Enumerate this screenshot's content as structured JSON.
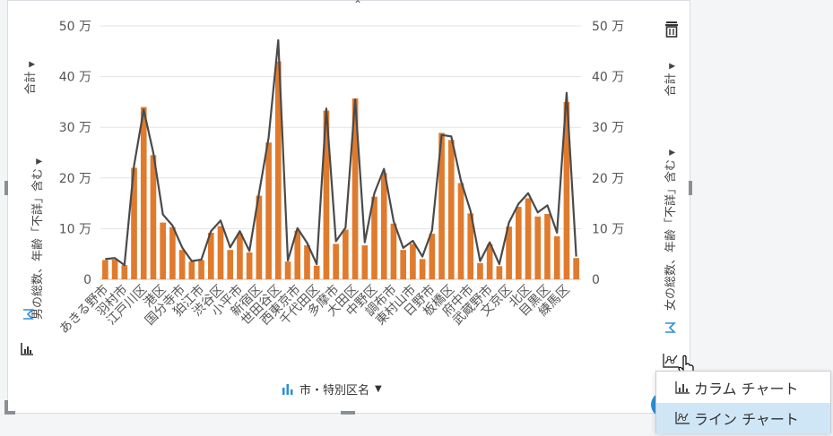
{
  "chart_data": {
    "type": "bar",
    "categories": [
      "あきる野市",
      "",
      "羽村市",
      "",
      "江戸川区",
      "",
      "港区",
      "",
      "国分寺市",
      "",
      "狛江市",
      "",
      "渋谷区",
      "",
      "小平市",
      "",
      "新宿区",
      "",
      "世田谷区",
      "",
      "西東京市",
      "",
      "千代田区",
      "",
      "多摩市",
      "",
      "大田区",
      "",
      "中野区",
      "",
      "調布市",
      "",
      "東村山市",
      "",
      "日野市",
      "",
      "板橋区",
      "",
      "府中市",
      "",
      "武蔵野市",
      "",
      "文京区",
      "",
      "北区",
      "",
      "目黒区",
      "",
      "練馬区",
      ""
    ],
    "series": [
      {
        "values": [
          3.8,
          3.9,
          2.8,
          22.0,
          34.0,
          24.5,
          11.2,
          10.3,
          5.8,
          3.5,
          3.8,
          9.2,
          10.5,
          5.8,
          9.0,
          5.3,
          16.5,
          27.0,
          43.0,
          3.5,
          9.6,
          6.7,
          2.7,
          33.3,
          7.0,
          9.8,
          35.7,
          6.7,
          16.3,
          21.0,
          11.0,
          5.8,
          7.0,
          4.0,
          9.0,
          28.9,
          27.5,
          19.0,
          13.0,
          3.2,
          6.9,
          2.6,
          10.4,
          14.3,
          16.0,
          12.4,
          12.9,
          8.5,
          35.0,
          4.2
        ]
      },
      {
        "values": [
          4.0,
          4.2,
          2.8,
          22.5,
          33.5,
          25.0,
          12.8,
          10.6,
          6.3,
          3.6,
          3.9,
          9.5,
          11.6,
          6.3,
          9.5,
          5.6,
          17.0,
          28.0,
          47.2,
          3.7,
          10.1,
          7.2,
          3.0,
          33.7,
          7.5,
          10.2,
          35.5,
          7.3,
          17.0,
          21.8,
          11.5,
          6.2,
          7.6,
          4.5,
          9.7,
          28.5,
          28.2,
          19.5,
          13.5,
          3.6,
          7.3,
          3.0,
          11.2,
          14.9,
          17.0,
          13.2,
          14.6,
          9.2,
          36.8,
          4.5
        ]
      }
    ],
    "y_ticks": [
      "0",
      "10 万",
      "20 万",
      "30 万",
      "40 万",
      "50 万"
    ],
    "ylim": [
      0,
      500000
    ],
    "unit_multiplier": 10000,
    "ylabel_left": "男の総数、年齢「不詳」含む",
    "ylabel_right": "女の総数、年齢「不詳」含む",
    "aggregate_left": "合計",
    "aggregate_right": "合計",
    "xlabel": "市・特別区名",
    "bar_color": "#e07b2e",
    "line_color": "#4a4a4a",
    "grid": true
  },
  "menu": {
    "items": [
      {
        "label": "カラム チャート",
        "selected": false
      },
      {
        "label": "ライン チャート",
        "selected": true
      }
    ]
  },
  "colors": {
    "accent": "#2d8fd5",
    "selection": "#cfe6f7"
  }
}
